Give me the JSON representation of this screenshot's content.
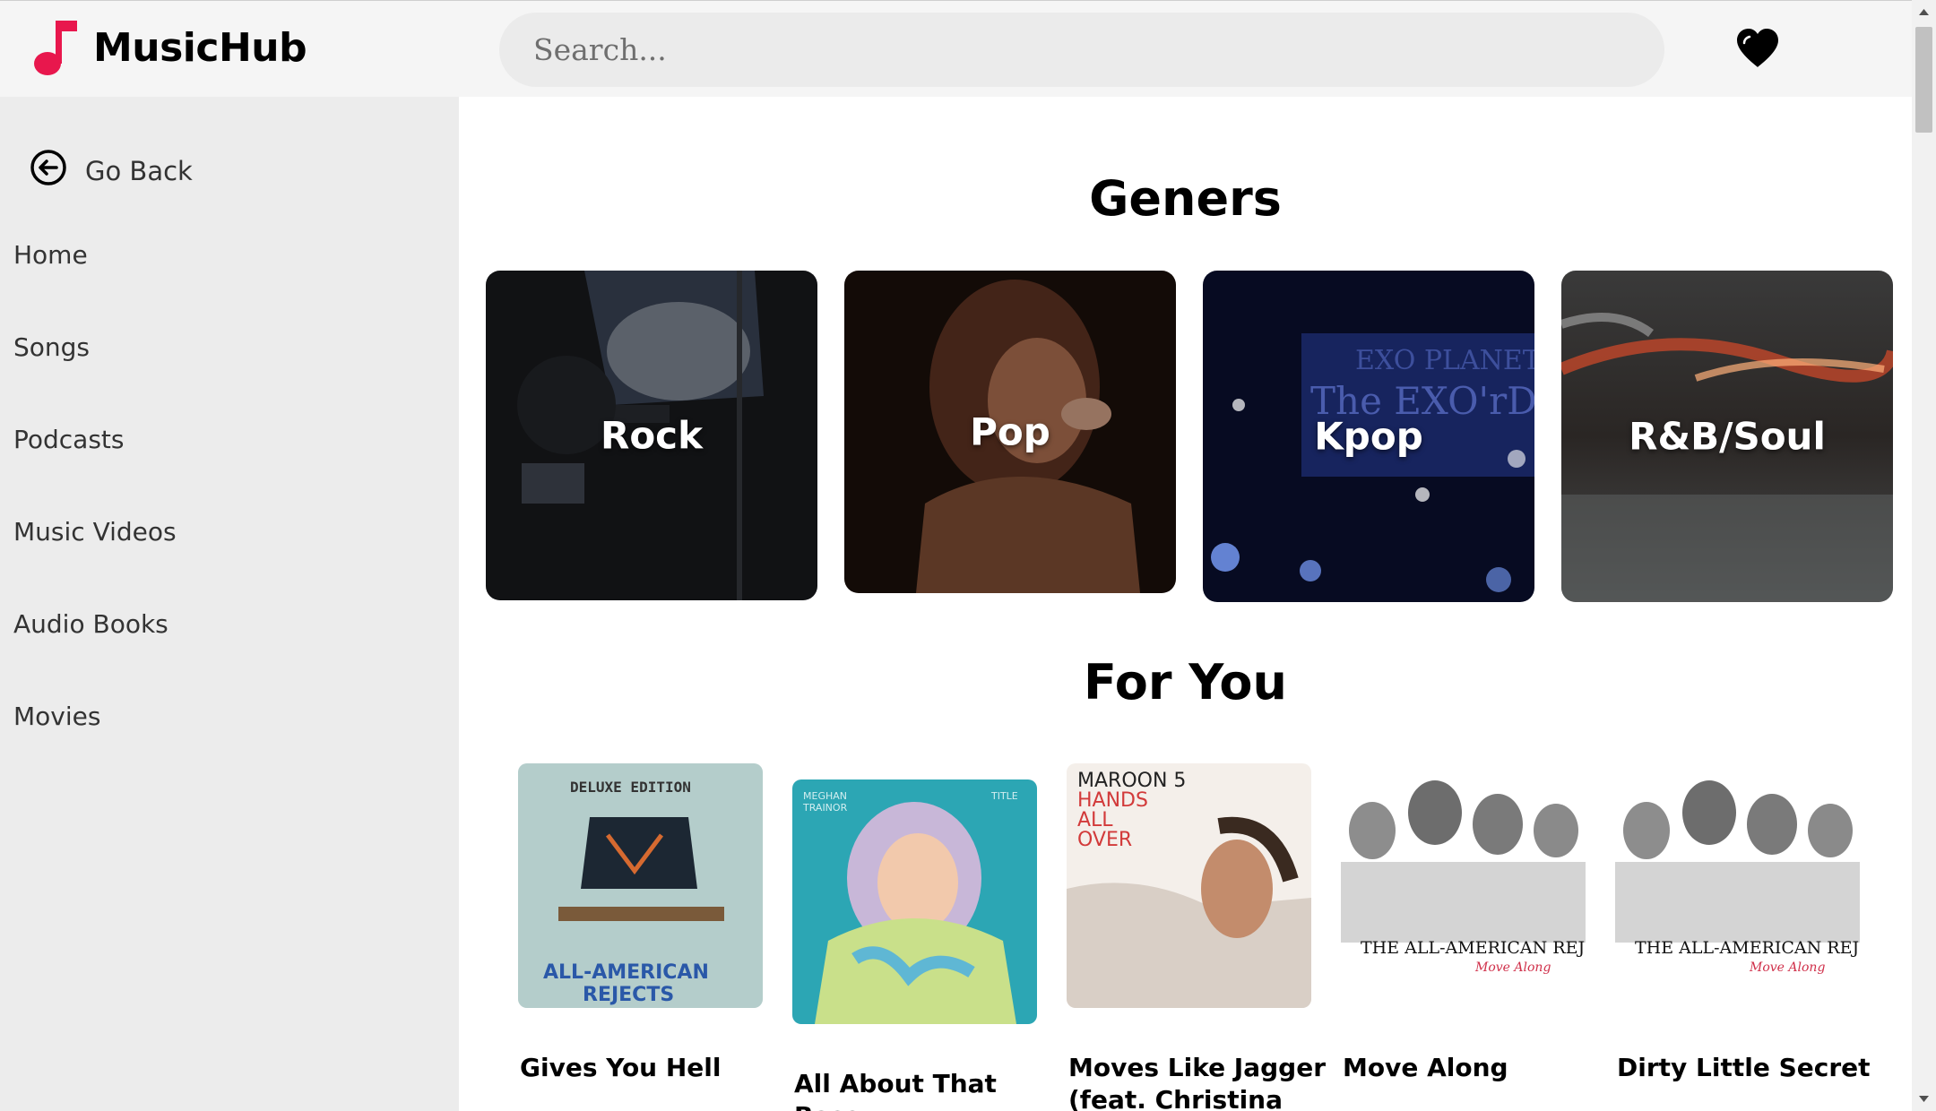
{
  "app": {
    "name": "MusicHub"
  },
  "header": {
    "search_placeholder": "Search...",
    "favorites_icon": "heart-icon"
  },
  "sidebar": {
    "go_back": "Go Back",
    "items": [
      {
        "label": "Home"
      },
      {
        "label": "Songs"
      },
      {
        "label": "Podcasts"
      },
      {
        "label": "Music Videos"
      },
      {
        "label": "Audio Books"
      },
      {
        "label": "Movies"
      }
    ]
  },
  "main": {
    "genres_title": "Geners",
    "genres": [
      {
        "label": "Rock"
      },
      {
        "label": "Pop"
      },
      {
        "label": "Kpop"
      },
      {
        "label": "R&B/Soul"
      }
    ],
    "for_you_title": "For You",
    "songs": [
      {
        "title": "Gives You Hell",
        "cover_text": [
          "DELUXE EDITION",
          "ALL-AMERICAN",
          "REJECTS"
        ]
      },
      {
        "title": "All About That Bass",
        "cover_text": [
          "MEGHAN",
          "TRAINOR",
          "TITLE"
        ]
      },
      {
        "title": "Moves Like Jagger (feat. Christina",
        "cover_text": [
          "MAROON 5",
          "HANDS",
          "ALL",
          "OVER"
        ]
      },
      {
        "title": "Move Along",
        "cover_text": [
          "THE ALL-AMERICAN REJECTS",
          "Move Along"
        ]
      },
      {
        "title": "Dirty Little Secret",
        "cover_text": [
          "THE ALL-AMERICAN REJECTS",
          "Move Along"
        ]
      }
    ]
  },
  "colors": {
    "brand": "#e8174d",
    "sidebar_bg": "#ececec",
    "header_bg": "#f5f5f5",
    "search_bg": "#ebebeb"
  }
}
